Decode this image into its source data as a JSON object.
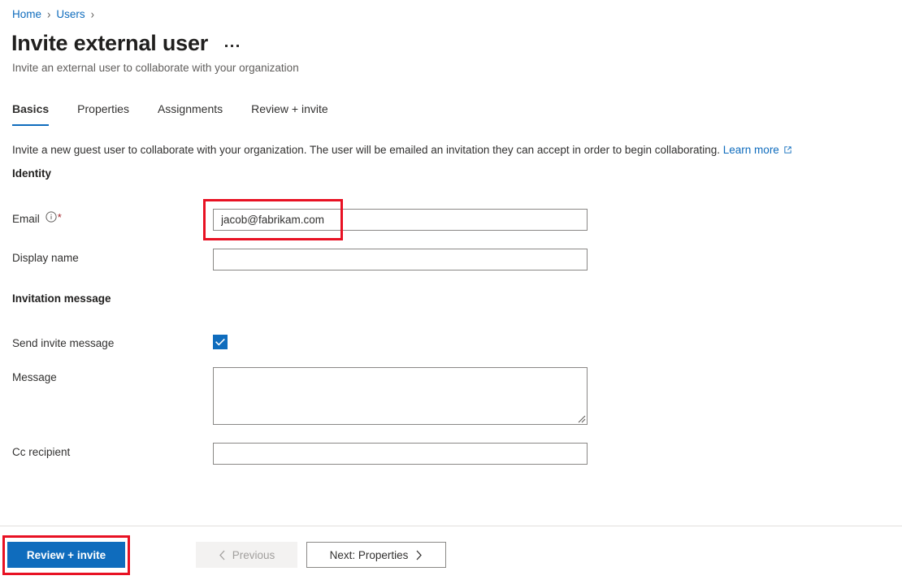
{
  "breadcrumb": {
    "items": [
      {
        "label": "Home"
      },
      {
        "label": "Users"
      }
    ],
    "separator": "›"
  },
  "header": {
    "title": "Invite external user",
    "subtitle": "Invite an external user to collaborate with your organization",
    "more_icon": "ellipsis-icon"
  },
  "tabs": [
    {
      "label": "Basics",
      "active": true
    },
    {
      "label": "Properties",
      "active": false
    },
    {
      "label": "Assignments",
      "active": false
    },
    {
      "label": "Review + invite",
      "active": false
    }
  ],
  "intro": {
    "text": "Invite a new guest user to collaborate with your organization. The user will be emailed an invitation they can accept in order to begin collaborating.",
    "link_label": "Learn more",
    "link_icon": "external-link-icon"
  },
  "sections": {
    "identity": {
      "heading": "Identity",
      "fields": {
        "email": {
          "label": "Email",
          "info_icon": "info-circle-icon",
          "required_marker": "*",
          "value": "jacob@fabrikam.com",
          "placeholder": ""
        },
        "display_name": {
          "label": "Display name",
          "value": "",
          "placeholder": ""
        }
      }
    },
    "invitation_message": {
      "heading": "Invitation message",
      "fields": {
        "send_invite_message": {
          "label": "Send invite message",
          "checked": true,
          "check_icon": "checkmark-icon"
        },
        "message": {
          "label": "Message",
          "value": "",
          "placeholder": ""
        },
        "cc_recipient": {
          "label": "Cc recipient",
          "value": "",
          "placeholder": ""
        }
      }
    }
  },
  "footer": {
    "primary_button": {
      "label": "Review + invite"
    },
    "previous_button": {
      "label": "Previous",
      "icon": "chevron-left-icon",
      "disabled": true
    },
    "next_button": {
      "label": "Next: Properties",
      "icon": "chevron-right-icon"
    }
  },
  "annotations": {
    "color": "#e81123",
    "email_field_highlight": true,
    "review_invite_highlight": true
  },
  "colors": {
    "accent": "#0f6cbd",
    "link": "#0f6cbd",
    "required": "#a4262c",
    "annotation": "#e81123",
    "border": "#8a8886",
    "divider": "#e1dfdd",
    "disabled_bg": "#f3f2f1",
    "disabled_text": "#a19f9d"
  }
}
